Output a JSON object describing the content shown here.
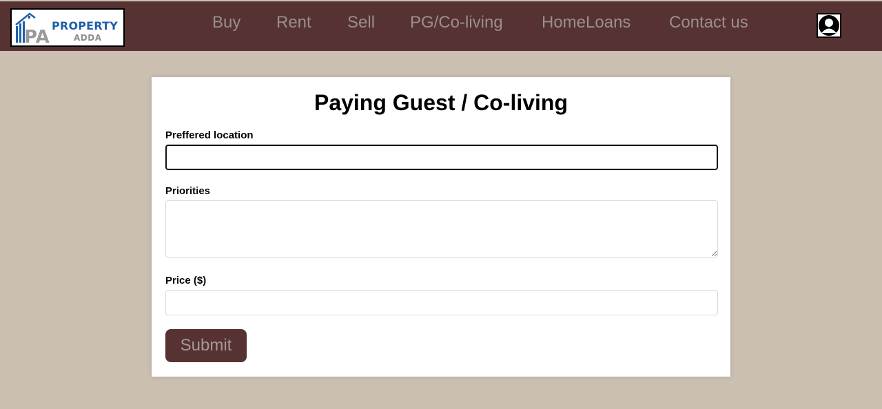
{
  "header": {
    "logo": {
      "brand": "PROPERTY",
      "sub": "ADDA",
      "mark": "PA"
    },
    "nav": [
      {
        "label": "Buy"
      },
      {
        "label": "Rent"
      },
      {
        "label": "Sell"
      },
      {
        "label": "PG/Co-living"
      },
      {
        "label": "HomeLoans"
      },
      {
        "label": "Contact us"
      }
    ],
    "avatar_icon": "user-avatar-icon"
  },
  "form": {
    "title": "Paying Guest / Co-living",
    "location": {
      "label": "Preffered location",
      "value": "",
      "placeholder": ""
    },
    "priorities": {
      "label": "Priorities",
      "value": "",
      "placeholder": ""
    },
    "price": {
      "label": "Price ($)",
      "value": "",
      "placeholder": ""
    },
    "submit_label": "Submit"
  },
  "colors": {
    "header_bg": "#573232",
    "page_bg": "#cbbfb1",
    "nav_text": "#9a8f8c",
    "button_bg": "#573232",
    "button_text": "#a8999c",
    "logo_blue": "#1f5fa8"
  }
}
